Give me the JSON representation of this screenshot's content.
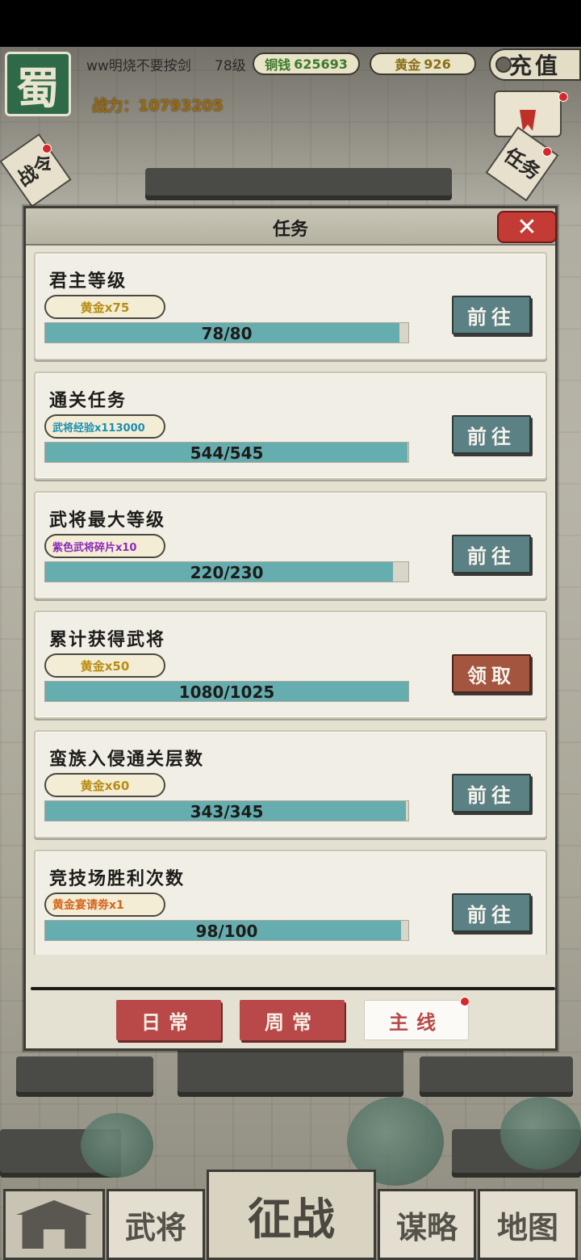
{
  "top_bar": {
    "kingdom": "蜀",
    "player_name": "ww明烧不要按剑",
    "level": "78级",
    "copper_label": "铜钱",
    "copper_value": "625693",
    "gold_label": "黄金",
    "gold_value": "926",
    "recharge_label": "充值",
    "power_label": "战力：",
    "power_value": "10793205",
    "left_tag": "战令",
    "right_tag": "任务"
  },
  "dialog": {
    "title": "任务",
    "close_symbol": "✕",
    "tasks": [
      {
        "title": "君主等级",
        "reward": "黄金x75",
        "reward_type": "gold",
        "progress_text": "78/80",
        "progress": 0.975,
        "button": "前往",
        "button_type": "goto"
      },
      {
        "title": "通关任务",
        "reward": "武将经验x113000",
        "reward_type": "exp",
        "progress_text": "544/545",
        "progress": 0.998,
        "button": "前往",
        "button_type": "goto"
      },
      {
        "title": "武将最大等级",
        "reward": "紫色武将碎片x10",
        "reward_type": "purple",
        "progress_text": "220/230",
        "progress": 0.957,
        "button": "前往",
        "button_type": "goto"
      },
      {
        "title": "累计获得武将",
        "reward": "黄金x50",
        "reward_type": "gold",
        "progress_text": "1080/1025",
        "progress": 1.0,
        "button": "领取",
        "button_type": "claim"
      },
      {
        "title": "蛮族入侵通关层数",
        "reward": "黄金x60",
        "reward_type": "gold",
        "progress_text": "343/345",
        "progress": 0.994,
        "button": "前往",
        "button_type": "goto"
      },
      {
        "title": "竞技场胜利次数",
        "reward": "黄金宴请劵x1",
        "reward_type": "orange",
        "progress_text": "98/100",
        "progress": 0.98,
        "button": "前往",
        "button_type": "goto"
      }
    ],
    "tabs": [
      {
        "label": "日常",
        "active": false
      },
      {
        "label": "周常",
        "active": false
      },
      {
        "label": "主线",
        "active": true
      }
    ]
  },
  "bottom_nav": {
    "wujiang": "武将",
    "zhengzhan": "征战",
    "moulue": "谋略",
    "ditu": "地图"
  },
  "colors": {
    "progress_fill": "#66adb0",
    "goto_button": "#5c8184",
    "claim_button": "#a3553f",
    "tab_red": "#b94848",
    "notification_dot": "#d8262b"
  }
}
